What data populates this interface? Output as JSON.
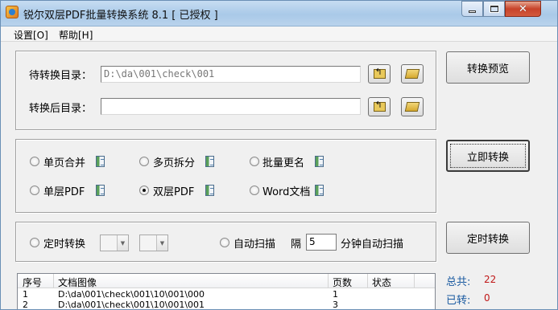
{
  "window": {
    "title": "锐尔双层PDF批量转换系统 8.1 [ 已授权 ]",
    "minimize_glyph": "",
    "maximize_glyph": "",
    "close_glyph": "✕"
  },
  "menu": {
    "items": [
      "设置[O]",
      "帮助[H]"
    ]
  },
  "directories": {
    "source_label": "待转换目录：",
    "source_value": "D:\\da\\001\\check\\001",
    "target_label": "转换后目录：",
    "target_value": ""
  },
  "modes": {
    "options": [
      {
        "label": "单页合并",
        "selected": false
      },
      {
        "label": "多页拆分",
        "selected": false
      },
      {
        "label": "批量更名",
        "selected": false
      },
      {
        "label": "单层PDF",
        "selected": false
      },
      {
        "label": "双层PDF",
        "selected": true
      },
      {
        "label": "Word文档",
        "selected": false
      }
    ]
  },
  "schedule": {
    "timed_label": "定时转换",
    "auto_scan_label": "自动扫描",
    "interval_prefix": "隔",
    "interval_value": "5",
    "interval_suffix": "分钟自动扫描"
  },
  "buttons": {
    "preview": "转换预览",
    "convert_now": "立即转换",
    "timed_convert": "定时转换"
  },
  "table": {
    "columns": [
      "序号",
      "文档图像",
      "页数",
      "状态"
    ],
    "rows": [
      {
        "index": "1",
        "path": "D:\\da\\001\\check\\001\\10\\001\\000",
        "pages": "1",
        "status": ""
      },
      {
        "index": "2",
        "path": "D:\\da\\001\\check\\001\\10\\001\\001",
        "pages": "3",
        "status": ""
      }
    ]
  },
  "stats": {
    "total_label": "总共:",
    "total_value": "22",
    "done_label": "已转:",
    "done_value": "0"
  }
}
